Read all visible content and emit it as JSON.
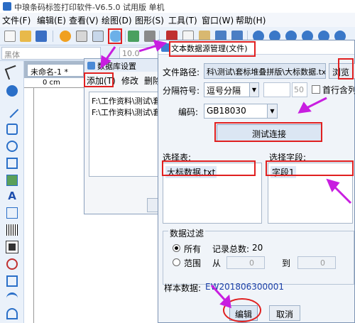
{
  "app": {
    "title": "中琅条码标签打印软件-V6.5.0 试用版 单机"
  },
  "menu": [
    "文件(F)",
    "编辑(E)",
    "查看(V)",
    "绘图(D)",
    "图形(S)",
    "工具(T)",
    "窗口(W)",
    "帮助(H)"
  ],
  "formatbar": {
    "font": "黑体",
    "size": "10.0"
  },
  "document": {
    "tab_label": "未命名-1 *",
    "ruler_zero": "0 cm"
  },
  "db_dialog": {
    "title": "数据库设置",
    "add_label": "添加(T)",
    "modify_label": "修改",
    "delete_label": "删除",
    "sources": [
      "F:\\工作资料\\测试\\套",
      "F:\\工作资料\\测试\\套"
    ]
  },
  "tds_dialog": {
    "title": "文本数据源管理(文件)",
    "path_label": "文件路径:",
    "path_value": "科\\测试\\套标堆叠拼版\\大标数据.txt",
    "browse_label": "浏览",
    "separator_label": "分隔符号:",
    "separator_value": "逗号分隔",
    "separator_spin": "50",
    "first_row_label": "首行含列名",
    "encoding_label": "编码:",
    "encoding_value": "GB18030",
    "test_label": "测试连接",
    "table_label": "选择表:",
    "table_selected": "大标数据.txt",
    "field_label": "选择字段:",
    "field_selected": "字段1",
    "filter_label": "数据过滤",
    "all_label": "所有",
    "total_label": "记录总数:",
    "total_value": "20",
    "range_label": "范围",
    "from_label": "从",
    "from_value": "0",
    "to_label": "到",
    "to_value": "0",
    "sample_label": "样本数据:",
    "sample_value": "EW201806300001",
    "edit_label": "编辑",
    "cancel_label": "取消"
  },
  "colors": {
    "highlight": "#e02020",
    "arrow": "#c81ee0",
    "accent": "#3d7ed3"
  }
}
